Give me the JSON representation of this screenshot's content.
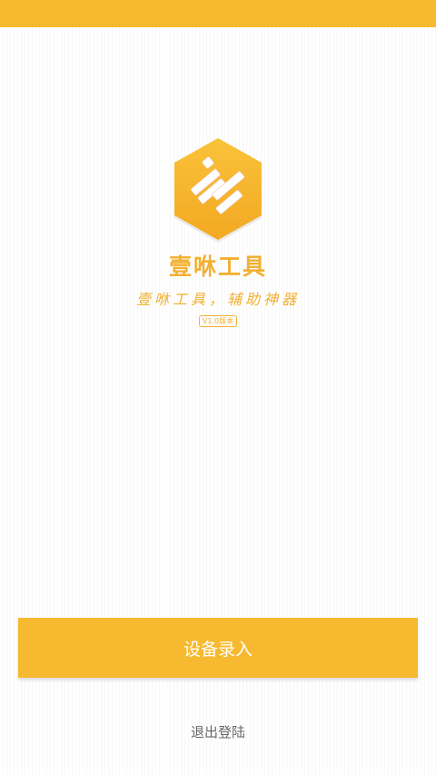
{
  "app": {
    "name": "壹咻工具",
    "slogan": "壹咻工具，辅助神器",
    "version": "V1.0版本"
  },
  "actions": {
    "device_entry_label": "设备录入",
    "logout_label": "退出登陆"
  },
  "colors": {
    "accent": "#f7b92f",
    "text_accent": "#f2b032",
    "secondary_text": "#666666"
  },
  "icons": {
    "logo": "app-logo-icon"
  }
}
